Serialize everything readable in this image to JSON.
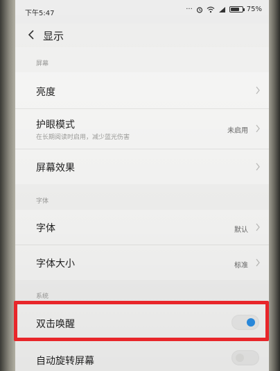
{
  "status_bar": {
    "time": "下午5:47",
    "icons": [
      "more-dots-icon",
      "alarm-icon",
      "wifi-icon",
      "signal-icon",
      "battery-icon"
    ],
    "battery_percent": "75%",
    "battery_level": 0.75
  },
  "header": {
    "back_icon": "chevron-left-icon",
    "title": "显示"
  },
  "sections": {
    "screen": {
      "label": "屏幕"
    },
    "font": {
      "label": "字体"
    },
    "system": {
      "label": "系统"
    }
  },
  "rows": {
    "brightness": {
      "label": "亮度"
    },
    "eye_care": {
      "label": "护眼模式",
      "subtitle": "在长期阅读时启用，减少蓝光伤害",
      "value": "未启用"
    },
    "screen_effect": {
      "label": "屏幕效果"
    },
    "font": {
      "label": "字体",
      "value": "默认"
    },
    "font_size": {
      "label": "字体大小",
      "value": "标准"
    },
    "double_tap_wake": {
      "label": "双击唤醒",
      "toggle_on": true
    },
    "auto_rotate": {
      "label": "自动旋转屏幕",
      "toggle_on": false
    }
  },
  "colors": {
    "accent": "#2b8fe6",
    "highlight": "#e8262a"
  }
}
